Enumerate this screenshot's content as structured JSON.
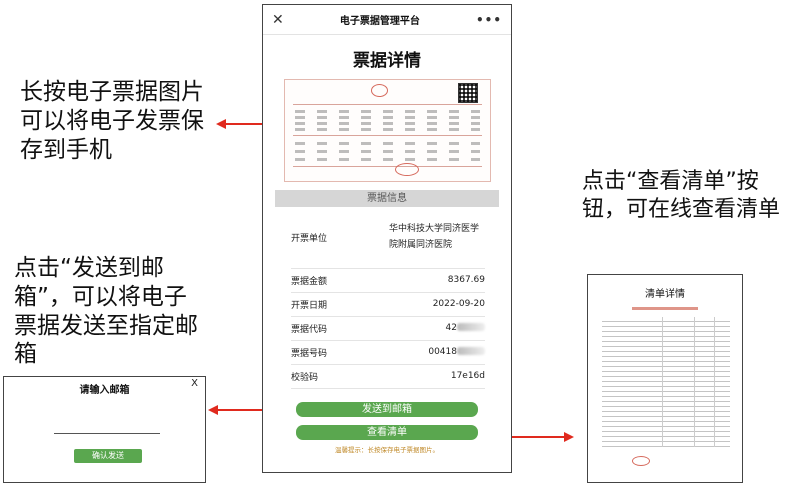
{
  "annotations": {
    "save_image": "长按电子票据图片可以将电子发票保存到手机",
    "view_list": "点击“查看清单”按钮，可在线查看清单",
    "send_email": "点击“发送到邮箱”，可以将电子票据发送至指定邮箱"
  },
  "phone": {
    "window_title": "电子票据管理平台",
    "close_icon": "close-icon",
    "more_icon": "more-icon",
    "page_title": "票据详情",
    "section_title": "票据信息",
    "fields": [
      {
        "label": "开票单位",
        "value": "华中科技大学同济医学院附属同济医院"
      },
      {
        "label": "票据金额",
        "value": "8367.69"
      },
      {
        "label": "开票日期",
        "value": "2022-09-20"
      },
      {
        "label": "票据代码",
        "value": "42"
      },
      {
        "label": "票据号码",
        "value": "00418"
      },
      {
        "label": "校验码",
        "value": "17e16d"
      }
    ],
    "send_button": "发送到邮箱",
    "list_button": "查看清单",
    "tip": "温馨提示：长按保存电子票据图片。"
  },
  "email_dialog": {
    "title": "请输入邮箱",
    "close": "X",
    "input_value": "",
    "confirm_button": "确认发送"
  },
  "list_panel": {
    "title": "清单详情"
  },
  "colors": {
    "accent_green": "#5aa74f",
    "arrow_red": "#e02a1e",
    "tip_orange": "#c08a2a"
  }
}
